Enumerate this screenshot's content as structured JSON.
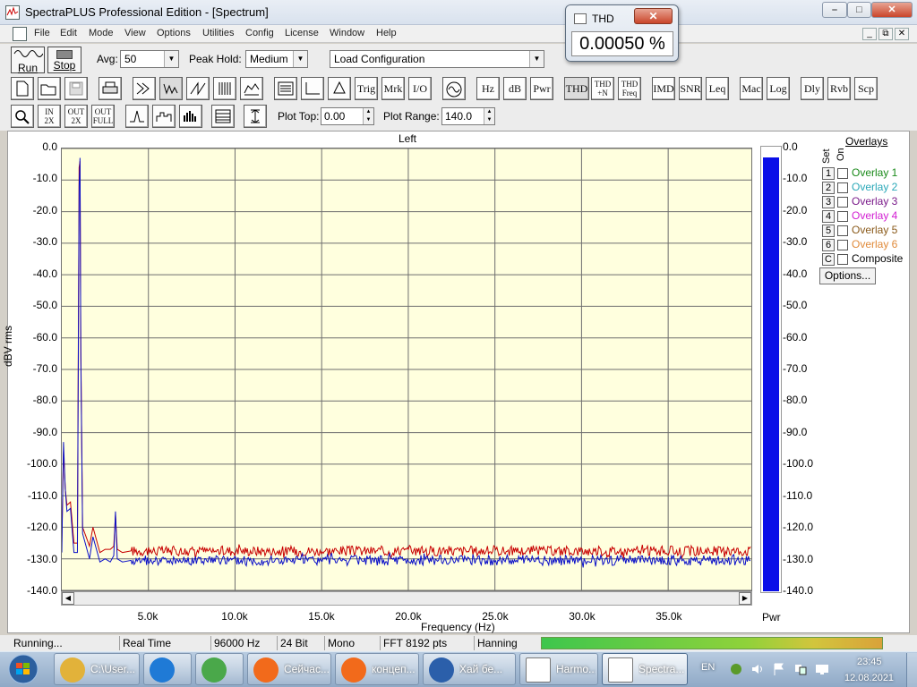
{
  "window": {
    "title": "SpectraPLUS Professional Edition - [Spectrum]",
    "min": "⎯",
    "max": "□",
    "close": "✕"
  },
  "menu": {
    "items": [
      "File",
      "Edit",
      "Mode",
      "View",
      "Options",
      "Utilities",
      "Config",
      "License",
      "Window",
      "Help"
    ],
    "mdi_min": "_",
    "mdi_restore": "⧉",
    "mdi_close": "✕"
  },
  "controls": {
    "run_label": "Run",
    "stop_label": "Stop",
    "avg_label": "Avg:",
    "avg_value": "50",
    "peak_hold_label": "Peak Hold:",
    "peak_hold_value": "Medium",
    "config_value": "Load Configuration"
  },
  "toolbar2": {
    "trig": "Trig",
    "mrk": "Mrk",
    "io": "I/O",
    "hz": "Hz",
    "db": "dB",
    "pwr": "Pwr",
    "thd": "THD",
    "thdn_top": "THD",
    "thdn_bottom": "+N",
    "thdfreq_top": "THD",
    "thdfreq_bottom": "Freq",
    "imd": "IMD",
    "snr": "SNR",
    "leq": "Leq",
    "mac": "Mac",
    "log": "Log",
    "dly": "Dly",
    "rvb": "Rvb",
    "scp": "Scp"
  },
  "toolbar3": {
    "zoom_in_top": "IN",
    "zoom_in_bottom": "2X",
    "zoom_out_top": "OUT",
    "zoom_out_bottom": "2X",
    "zoom_full_top": "OUT",
    "zoom_full_bottom": "FULL",
    "plot_top_label": "Plot Top:",
    "plot_top_value": "0.00",
    "plot_range_label": "Plot Range:",
    "plot_range_value": "140.0"
  },
  "thd_window": {
    "title": "THD",
    "close": "✕",
    "value": "0.00050 %"
  },
  "overlays": {
    "title": "Overlays",
    "set_label": "Set",
    "on_label": "On",
    "items": [
      {
        "num": "1",
        "label": "Overlay 1",
        "color": "#1a8a1a"
      },
      {
        "num": "2",
        "label": "Overlay 2",
        "color": "#2aa8b8"
      },
      {
        "num": "3",
        "label": "Overlay 3",
        "color": "#7a1a8a"
      },
      {
        "num": "4",
        "label": "Overlay 4",
        "color": "#d21ed2"
      },
      {
        "num": "5",
        "label": "Overlay 5",
        "color": "#8a5a1a"
      },
      {
        "num": "6",
        "label": "Overlay 6",
        "color": "#e08a3a"
      },
      {
        "num": "C",
        "label": "Composite",
        "color": "#000000"
      }
    ],
    "options_label": "Options..."
  },
  "status": {
    "state": "Running...",
    "mode": "Real Time",
    "sample_rate": "96000 Hz",
    "bits": "24 Bit",
    "channels": "Mono",
    "fft": "FFT 8192 pts",
    "window": "Hanning"
  },
  "pwr_meter": {
    "label": "Pwr",
    "level_db": -3.0,
    "color": "#0a0fe8",
    "ticks": [
      "0.0",
      "-10.0",
      "-20.0",
      "-30.0",
      "-40.0",
      "-50.0",
      "-60.0",
      "-70.0",
      "-80.0",
      "-90.0",
      "-100.0",
      "-110.0",
      "-120.0",
      "-130.0",
      "-140.0"
    ]
  },
  "chart_data": {
    "type": "line",
    "title": "Left",
    "xlabel": "Frequency (Hz)",
    "ylabel": "dBV rms",
    "xlim": [
      0,
      39800
    ],
    "ylim": [
      -140,
      0
    ],
    "grid": true,
    "y_ticks": [
      "0.0",
      "-10.0",
      "-20.0",
      "-30.0",
      "-40.0",
      "-50.0",
      "-60.0",
      "-70.0",
      "-80.0",
      "-90.0",
      "-100.0",
      "-110.0",
      "-120.0",
      "-130.0",
      "-140.0"
    ],
    "x_ticks": [
      {
        "value": 5000,
        "label": "5.0k"
      },
      {
        "value": 10000,
        "label": "10.0k"
      },
      {
        "value": 15000,
        "label": "15.0k"
      },
      {
        "value": 20000,
        "label": "20.0k"
      },
      {
        "value": 25000,
        "label": "25.0k"
      },
      {
        "value": 30000,
        "label": "30.0k"
      },
      {
        "value": 35000,
        "label": "35.0k"
      }
    ],
    "series": [
      {
        "color": "#c80000",
        "noise_floor": -127.5,
        "x": [
          0,
          100,
          200,
          300,
          500,
          700,
          900,
          1000,
          1050,
          1100,
          1200,
          1400,
          1600,
          1800,
          2000,
          2200,
          2500,
          2800,
          3000,
          3100,
          3200,
          3500,
          4000
        ],
        "y": [
          -125,
          -96,
          -108,
          -113,
          -112,
          -125,
          -125,
          -6,
          -4,
          -63,
          -120,
          -123,
          -126,
          -120,
          -124,
          -128,
          -127,
          -127,
          -126,
          -116,
          -127,
          -128,
          -127.5
        ]
      },
      {
        "color": "#0a0fc8",
        "noise_floor": -130.5,
        "x": [
          0,
          100,
          200,
          300,
          500,
          700,
          900,
          1000,
          1050,
          1100,
          1200,
          1400,
          1600,
          1800,
          2000,
          2200,
          2500,
          2800,
          3000,
          3100,
          3200,
          3500,
          4000
        ],
        "y": [
          -128,
          -93,
          -108,
          -115,
          -114,
          -128,
          -128,
          -12,
          -3,
          -66,
          -122,
          -126,
          -130,
          -123,
          -127,
          -131,
          -130,
          -131,
          -129,
          -115,
          -130,
          -131,
          -130.5
        ]
      }
    ]
  },
  "taskbar": {
    "items": [
      {
        "label": "C:\\User...",
        "color": "#e2b23a"
      },
      {
        "label": "",
        "color": "#1f7ad6"
      },
      {
        "label": "",
        "color": "#4aa84a"
      },
      {
        "label": "Сейчас...",
        "color": "#f26a1b"
      },
      {
        "label": "концеп...",
        "color": "#f26a1b"
      },
      {
        "label": "Хай бе...",
        "color": "#2b5faa"
      },
      {
        "label": "Harmo...",
        "color": "#ffffff"
      },
      {
        "label": "Spectra...",
        "color": "#ffffff"
      }
    ],
    "lang": "EN",
    "time": "23:45",
    "date": "12.08.2021"
  }
}
